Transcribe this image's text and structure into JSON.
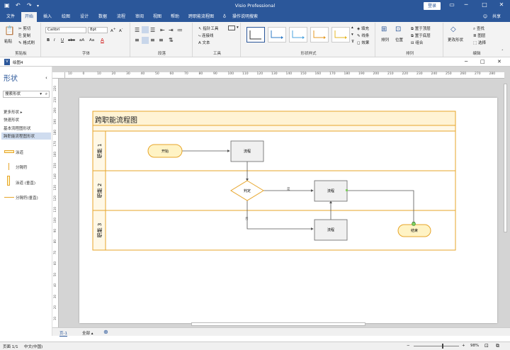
{
  "app_title": "Visio Professional",
  "login_label": "登录",
  "tabs": [
    "文件",
    "开始",
    "插入",
    "绘图",
    "设计",
    "数据",
    "流程",
    "审阅",
    "视图",
    "帮助",
    "跨职能流程图"
  ],
  "tell_me": "操作说明搜索",
  "share_label": "共享",
  "clipboard": {
    "paste": "粘贴",
    "cut": "剪切",
    "copy": "复制",
    "format_painter": "格式刷",
    "group": "剪贴板"
  },
  "font": {
    "name": "Calibri",
    "size": "8pt",
    "group": "字体"
  },
  "paragraph": {
    "group": "段落"
  },
  "tools": {
    "pointer": "指针工具",
    "connector": "连接线",
    "text": "文本",
    "group": "工具"
  },
  "shape_styles": {
    "fill": "填充",
    "line": "线条",
    "effects": "效果",
    "group": "形状样式"
  },
  "arrange": {
    "arrange": "排列",
    "position": "位置",
    "bring_front": "置于顶层",
    "send_back": "置于底层",
    "group_label": "组合",
    "group": "排列"
  },
  "editing": {
    "change_shape": "更改形状",
    "find": "查找",
    "layers": "图层",
    "select": "选择",
    "group": "编辑"
  },
  "document_tab": "绘图4",
  "shapes_panel": {
    "title": "形状",
    "search_placeholder": "搜索形状",
    "more_shapes": "更多形状",
    "quick_shapes": "快速形状",
    "basic_flowchart": "基本流程图形状",
    "crossfunc": "跨职能流程图形状",
    "stencil": [
      "泳道",
      "分隔符",
      "泳道 (垂直)",
      "分隔符(垂直)"
    ]
  },
  "ruler_top": [
    "10",
    "0",
    "10",
    "20",
    "30",
    "40",
    "50",
    "60",
    "70",
    "80",
    "90",
    "100",
    "110",
    "120",
    "130",
    "140",
    "150",
    "160",
    "170",
    "180",
    "190",
    "200",
    "210",
    "220",
    "230",
    "240",
    "250",
    "260",
    "270",
    "280"
  ],
  "ruler_left": [
    "220",
    "210",
    "200",
    "190",
    "180",
    "170",
    "160",
    "150",
    "140",
    "130",
    "120",
    "110",
    "100",
    "90",
    "80",
    "70",
    "60",
    "50",
    "40",
    "30",
    "20",
    "10"
  ],
  "diagram": {
    "title": "跨职能流程图",
    "lanes": [
      "职能 1",
      "职能 2",
      "职能 3"
    ],
    "start": "开始",
    "process1": "流程",
    "decision": "判定",
    "process2": "流程",
    "process3": "流程",
    "end": "结束",
    "yes_label": "是",
    "no_label": "否"
  },
  "page_tab": "页-1",
  "all_pages": "全部",
  "status": {
    "page": "页面 1/1",
    "language": "中文(中国)",
    "zoom": "98%"
  },
  "colors": {
    "accent": "#2b579a",
    "lane_border": "#e7a52a",
    "start_fill": "#fff3c4"
  }
}
